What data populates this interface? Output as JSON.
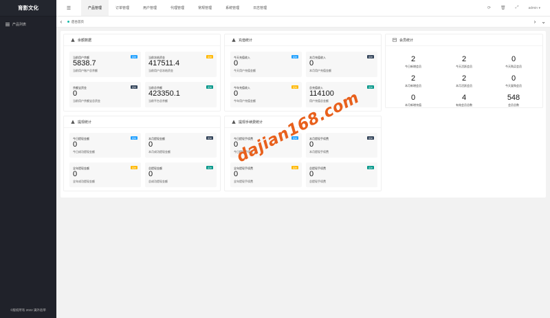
{
  "app": {
    "title": "育影文化",
    "footer": "©版权所有 2022 满外验单",
    "user": "admin"
  },
  "sidebar": {
    "items": [
      {
        "label": "产品列表"
      }
    ]
  },
  "topnav": {
    "tabs": [
      {
        "label": "产品管理",
        "active": true
      },
      {
        "label": "订单管理",
        "active": false
      },
      {
        "label": "用户管理",
        "active": false
      },
      {
        "label": "代理管理",
        "active": false
      },
      {
        "label": "常规管理",
        "active": false
      },
      {
        "label": "系统管理",
        "active": false
      },
      {
        "label": "日志管理",
        "active": false
      }
    ]
  },
  "tabbar": {
    "home_label": "后台首页"
  },
  "balance": {
    "title": "余额数据",
    "boxes": [
      {
        "title": "当前用户余额",
        "value": "5838.7",
        "desc": "当前用户账户总余额",
        "badge": "实时",
        "badge_color": "#1e9fff"
      },
      {
        "title": "当前冻结资金",
        "value": "417511.4",
        "desc": "当前用户总冻结资金",
        "badge": "实时",
        "badge_color": "#ffb800"
      },
      {
        "title": "余额宝资金",
        "value": "0",
        "desc": "当前用户余额宝总资金",
        "badge": "实时",
        "badge_color": "#2f4056"
      },
      {
        "title": "当前总余额",
        "value": "423350.1",
        "desc": "当前平台总余额",
        "badge": "实时",
        "badge_color": "#009688"
      }
    ]
  },
  "recharge": {
    "title": "充值统计",
    "boxes": [
      {
        "title": "今天充值收入",
        "value": "0",
        "desc": "今天用户充值金额",
        "badge": "实时",
        "badge_color": "#1e9fff"
      },
      {
        "title": "本月充值收入",
        "value": "0",
        "desc": "本月用户充值金额",
        "badge": "实时",
        "badge_color": "#2f4056"
      },
      {
        "title": "今年充值收入",
        "value": "0",
        "desc": "今年用户充值金额",
        "badge": "实时",
        "badge_color": "#ffb800"
      },
      {
        "title": "总充值收入",
        "value": "114100",
        "desc": "用户充值总金额",
        "badge": "实时",
        "badge_color": "#009688"
      }
    ]
  },
  "members": {
    "title": "会员统计",
    "stats": [
      {
        "value": "2",
        "label": "今日新增会员"
      },
      {
        "value": "2",
        "label": "今天活跃会员"
      },
      {
        "value": "0",
        "label": "今天购买会员"
      },
      {
        "value": "2",
        "label": "本月新增会员"
      },
      {
        "value": "2",
        "label": "本月活跃会员"
      },
      {
        "value": "0",
        "label": "今天复购会员"
      },
      {
        "value": "0",
        "label": "本月新增充值"
      },
      {
        "value": "4",
        "label": "有效会员总数"
      },
      {
        "value": "548",
        "label": "会员总数"
      }
    ]
  },
  "withdraw": {
    "title": "提现统计",
    "boxes": [
      {
        "title": "今日提现金额",
        "value": "0",
        "desc": "今日成功提现金额",
        "badge": "实时",
        "badge_color": "#1e9fff"
      },
      {
        "title": "本月提现金额",
        "value": "0",
        "desc": "本月成功提现金额",
        "badge": "实时",
        "badge_color": "#2f4056"
      },
      {
        "title": "全年提现金额",
        "value": "0",
        "desc": "全年成功提现金额",
        "badge": "实时",
        "badge_color": "#ffb800"
      },
      {
        "title": "总提现金额",
        "value": "0",
        "desc": "总成功提现金额",
        "badge": "实时",
        "badge_color": "#009688"
      }
    ]
  },
  "fees": {
    "title": "提现手续费统计",
    "boxes": [
      {
        "title": "今日提现手续费",
        "value": "0",
        "desc": "今日提现手续费",
        "badge": "实时",
        "badge_color": "#1e9fff"
      },
      {
        "title": "本月提现手续费",
        "value": "0",
        "desc": "本月提现手续费",
        "badge": "实时",
        "badge_color": "#2f4056"
      },
      {
        "title": "全年提现手续费",
        "value": "0",
        "desc": "全年提现手续费",
        "badge": "实时",
        "badge_color": "#ffb800"
      },
      {
        "title": "总提现手续费",
        "value": "0",
        "desc": "总提现手续费",
        "badge": "实时",
        "badge_color": "#009688"
      }
    ]
  },
  "watermark": {
    "text": "dajian168.com",
    "color": "#e8601c"
  }
}
